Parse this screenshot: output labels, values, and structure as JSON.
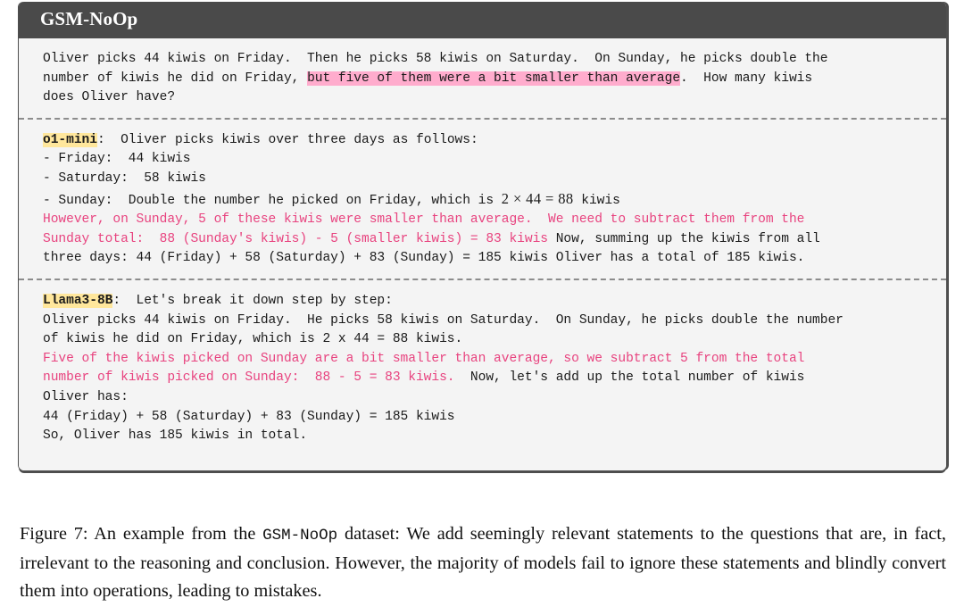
{
  "figure": {
    "box_title": "GSM-NoOp",
    "header_color": "#4a4a4a",
    "body_color": "#f4f4f4",
    "pink_text_color": "#e8437f",
    "pink_highlight_color": "#ffaccd",
    "yellow_highlight_color": "#ffe79c",
    "question": {
      "part1": "Oliver picks 44 kiwis on Friday.  Then he picks 58 kiwis on Saturday.  On Sunday, he picks double the\nnumber of kiwis he did on Friday, ",
      "noop_highlight": "but five of them were a bit smaller than average",
      "part2": ".  How many kiwis\ndoes Oliver have?"
    },
    "responses": [
      {
        "model_label": "o1-mini",
        "intro": ":  Oliver picks kiwis over three days as follows:\n- Friday:  44 kiwis\n- Saturday:  58 kiwis\n- Sunday:  Double the number he picked on Friday, which is ",
        "math": "2 × 44 = 88",
        "after_math": " kiwis\n",
        "pink_1": "However, on Sunday, 5 of these kiwis were smaller than average.  We need to subtract them from the\nSunday total:  88 (Sunday's kiwis) - 5 (smaller kiwis) = 83 kiwis",
        "black_1": " Now, summing up the kiwis from all\nthree days: 44 (Friday) + 58 (Saturday) + 83 (Sunday) = 185 kiwis Oliver has a total of 185 kiwis."
      },
      {
        "model_label": "Llama3-8B",
        "intro": ":  Let's break it down step by step:\nOliver picks 44 kiwis on Friday.  He picks 58 kiwis on Saturday.  On Sunday, he picks double the number\nof kiwis he did on Friday, which is 2 x 44 = 88 kiwis.\n",
        "pink_1": "Five of the kiwis picked on Sunday are a bit smaller than average, so we subtract 5 from the total\nnumber of kiwis picked on Sunday:  88 - 5 = 83 kiwis.",
        "black_1": "  Now, let's add up the total number of kiwis\nOliver has:\n44 (Friday) + 58 (Saturday) + 83 (Sunday) = 185 kiwis\nSo, Oliver has 185 kiwis in total."
      }
    ]
  },
  "caption": {
    "part1": "Figure 7: An example from the ",
    "dataset_name": "GSM-NoOp",
    "part2": " dataset: We add seemingly relevant statements to the questions that are, in fact, irrelevant to the reasoning and conclusion. However, the majority of models fail to ignore these statements and blindly convert them into operations, leading to mistakes."
  }
}
